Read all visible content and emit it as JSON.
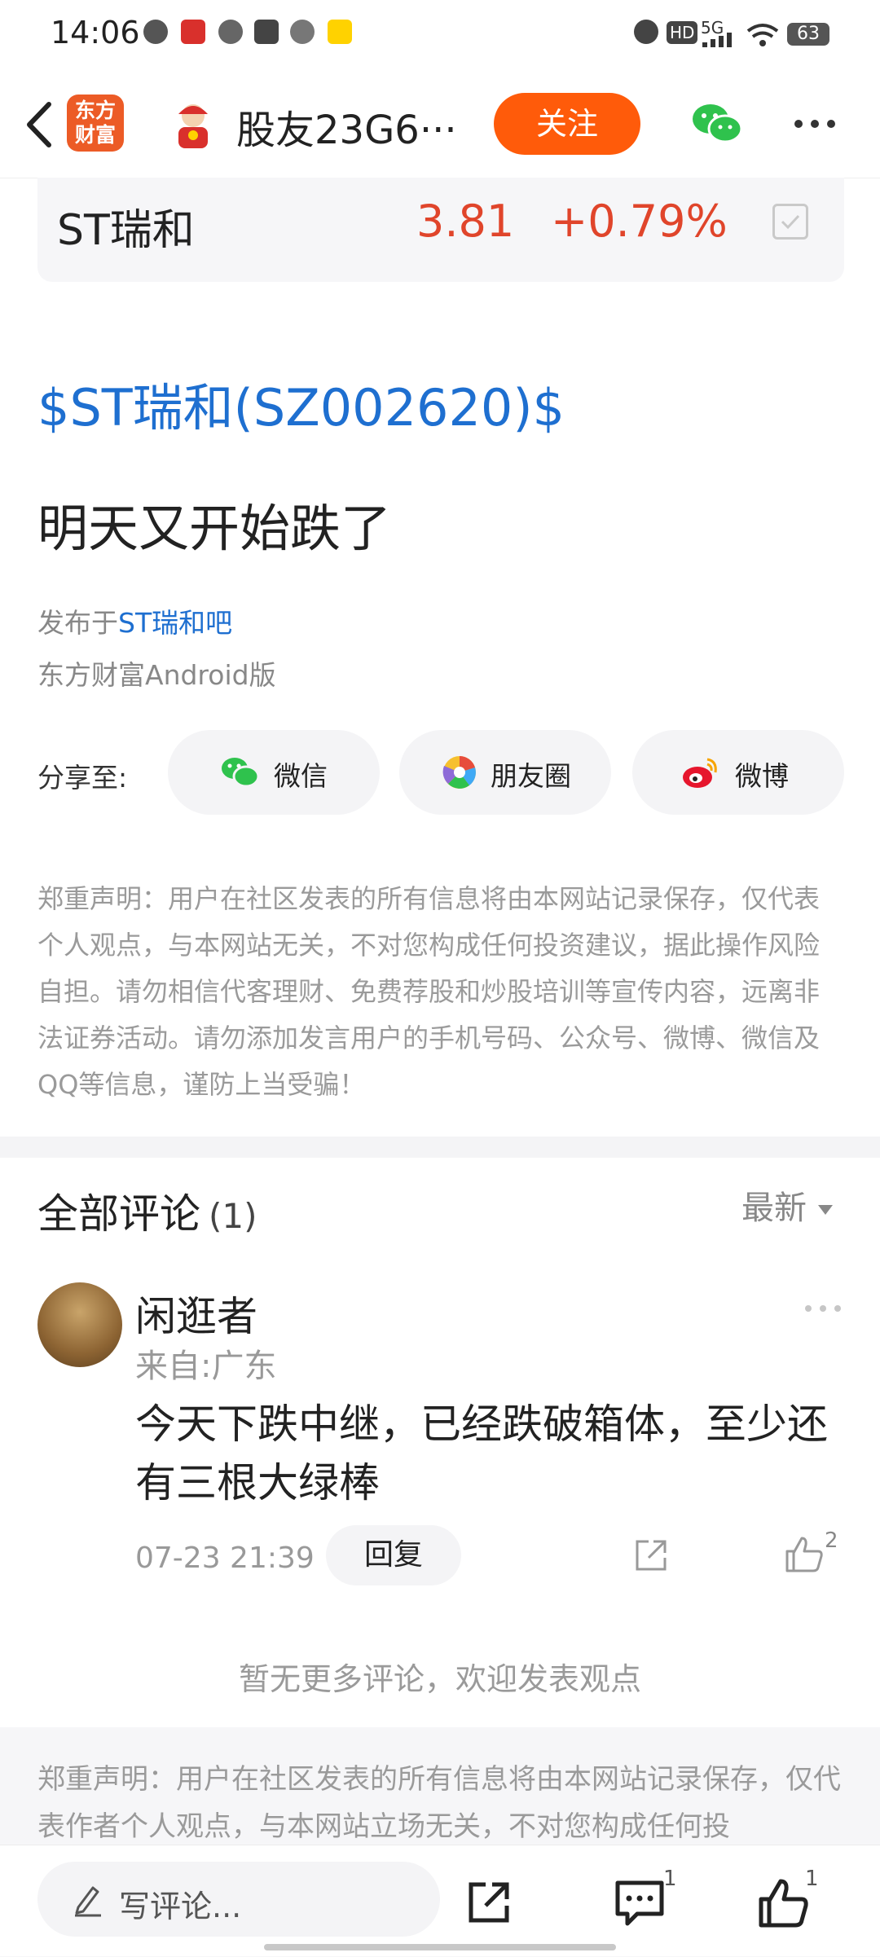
{
  "status_bar": {
    "time": "14:06",
    "network": "5G",
    "hd": "HD",
    "battery": "63"
  },
  "header": {
    "app_logo_line1": "东方",
    "app_logo_line2": "财富",
    "user_name": "股友23G6···",
    "follow_label": "关注",
    "brand_color": "#ff5b0a"
  },
  "stock": {
    "name": "ST瑞和",
    "price": "3.81",
    "change": "+0.79%",
    "change_color": "#e0452b"
  },
  "post": {
    "tag": "$ST瑞和(SZ002620)$",
    "title": "明天又开始跌了",
    "source_prefix": "发布于",
    "source_link": "ST瑞和吧",
    "client": "东方财富Android版"
  },
  "share": {
    "label": "分享至:",
    "buttons": [
      {
        "label": "微信",
        "icon": "wechat-icon"
      },
      {
        "label": "朋友圈",
        "icon": "moments-icon"
      },
      {
        "label": "微博",
        "icon": "weibo-icon"
      }
    ]
  },
  "disclaimer_top": "郑重声明：用户在社区发表的所有信息将由本网站记录保存，仅代表个人观点，与本网站无关，不对您构成任何投资建议，据此操作风险自担。请勿相信代客理财、免费荐股和炒股培训等宣传内容，远离非法证券活动。请勿添加发言用户的手机号码、公众号、微博、微信及QQ等信息，谨防上当受骗！",
  "comments": {
    "title": "全部评论",
    "count": "(1)",
    "sort": "最新",
    "items": [
      {
        "author": "闲逛者",
        "location": "来自:广东",
        "body": "今天下跌中继，已经跌破箱体，至少还有三根大绿棒",
        "time": "07-23 21:39",
        "reply_label": "回复",
        "likes": "2"
      }
    ],
    "no_more": "暂无更多评论，欢迎发表观点"
  },
  "disclaimer_bottom": "郑重声明：用户在社区发表的所有信息将由本网站记录保存，仅代表作者个人观点，与本网站立场无关，不对您构成任何投",
  "bottom_bar": {
    "placeholder": "写评论...",
    "comment_count": "1",
    "like_count": "1"
  }
}
